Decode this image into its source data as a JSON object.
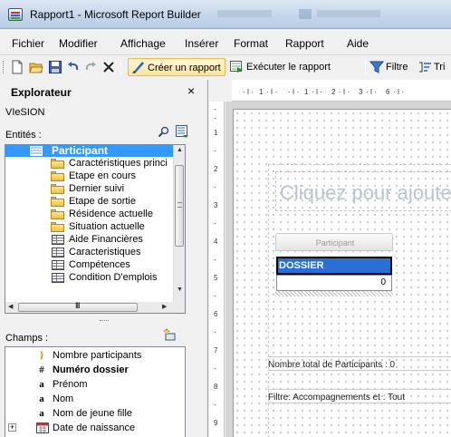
{
  "window": {
    "title": "Rapport1 - Microsoft Report Builder"
  },
  "menu": [
    "Fichier",
    "Modifier",
    "Affichage",
    "Insérer",
    "Format",
    "Rapport",
    "Aide"
  ],
  "toolbar": {
    "create_report": "Créer un rapport",
    "run_report": "Exécuter le rapport",
    "filter": "Filtre",
    "sort": "Tri"
  },
  "explorer": {
    "title": "Explorateur",
    "close": "×",
    "model": "VIeSION",
    "entities_label": "Entités :",
    "selected_entity": "Participant",
    "entities": [
      {
        "label": "Caractéristiques princi",
        "icon": "folder"
      },
      {
        "label": "Etape en cours",
        "icon": "folder"
      },
      {
        "label": "Dernier suivi",
        "icon": "folder"
      },
      {
        "label": "Etape de sortie",
        "icon": "folder"
      },
      {
        "label": "Résidence actuelle",
        "icon": "folder"
      },
      {
        "label": "Situation actuelle",
        "icon": "folder"
      },
      {
        "label": "Aide Financières",
        "icon": "table"
      },
      {
        "label": "Caracteristiques",
        "icon": "table"
      },
      {
        "label": "Compétences",
        "icon": "table"
      },
      {
        "label": "Condition D'emplois",
        "icon": "table"
      }
    ],
    "fields_label": "Champs :",
    "fields": [
      {
        "icon": "}",
        "label": "Nombre participants",
        "bold": false
      },
      {
        "icon": "#",
        "label": "Numéro dossier",
        "bold": true
      },
      {
        "icon": "a",
        "label": "Prénom",
        "bold": false
      },
      {
        "icon": "a",
        "label": "Nom",
        "bold": false
      },
      {
        "icon": "a",
        "label": "Nom de jeune fille",
        "bold": false
      },
      {
        "icon": "calendar",
        "label": "Date de naissance",
        "bold": false
      }
    ]
  },
  "ruler": {
    "horizontal": [
      "1",
      "1",
      "2",
      "3",
      "6"
    ],
    "vertical": [
      "1",
      "2",
      "3",
      "4",
      "5",
      "6",
      "7",
      "8",
      "9"
    ]
  },
  "report": {
    "title_placeholder": "Cliquez pour ajouter un titre",
    "table_header": "Participant",
    "column": "DOSSIER",
    "value": "0",
    "footer_total": "Nombre total de Participants : 0",
    "footer_filter": "Filtre: Accompagnements et : Tout"
  }
}
